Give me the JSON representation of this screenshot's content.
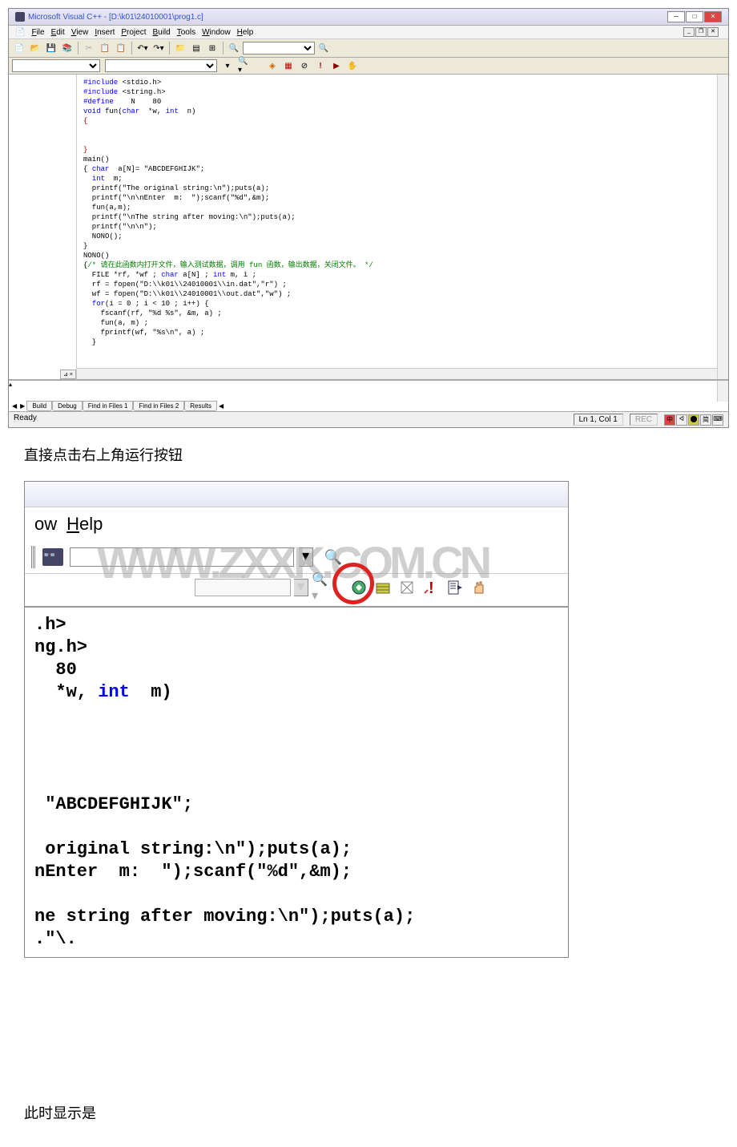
{
  "ide": {
    "title": "Microsoft Visual C++ - [D:\\k01\\24010001\\prog1.c]",
    "menubar": {
      "file": "File",
      "edit": "Edit",
      "view": "View",
      "insert": "Insert",
      "project": "Project",
      "build": "Build",
      "tools": "Tools",
      "window": "Window",
      "help": "Help"
    },
    "code": {
      "l1a": "#include",
      "l1b": " <stdio.h>",
      "l2a": "#include",
      "l2b": " <string.h>",
      "l3a": "#define",
      "l3b": "    N    80",
      "l4a": "void",
      "l4b": " fun(",
      "l4c": "char",
      "l4d": "  *w, ",
      "l4e": "int",
      "l4f": "  n)",
      "l5": "{",
      "l6": "",
      "l7": "}",
      "l8": "main()",
      "l9a": "{ ",
      "l9b": "char",
      "l9c": "  a[N]= \"ABCDEFGHIJK\";",
      "l10a": "  ",
      "l10b": "int",
      "l10c": "  m;",
      "l11": "  printf(\"The original string:\\n\");puts(a);",
      "l12": "  printf(\"\\n\\nEnter  m:  \");scanf(\"%d\",&m);",
      "l13": "  fun(a,m);",
      "l14": "  printf(\"\\nThe string after moving:\\n\");puts(a);",
      "l15": "  printf(\"\\n\\n\");",
      "l16": "  NONO();",
      "l17": "}",
      "l18": "NONO()",
      "l19a": "{",
      "l19b": "/* 请在此函数内打开文件，输入测试数据，调用 fun 函数，输出数据，关闭文件。 */",
      "l20": "  FILE *rf, *wf ; ",
      "l20b": "char",
      "l20c": " a[N] ; ",
      "l20d": "int",
      "l20e": " m, i ;",
      "l21": "  rf = fopen(\"D:\\\\k01\\\\24010001\\\\in.dat\",\"r\") ;",
      "l22": "  wf = fopen(\"D:\\\\k01\\\\24010001\\\\out.dat\",\"w\") ;",
      "l23a": "  ",
      "l23b": "for",
      "l23c": "(i = 0 ; i < 10 ; i++) {",
      "l24": "    fscanf(rf, \"%d %s\", &m, a) ;",
      "l25": "    fun(a, m) ;",
      "l26": "    fprintf(wf, \"%s\\n\", a) ;",
      "l27": "  }"
    },
    "output_tabs": {
      "build": "Build",
      "debug": "Debug",
      "find1": "Find in Files 1",
      "find2": "Find in Files 2",
      "results": "Results"
    },
    "statusbar": {
      "ready": "Ready",
      "pos": "Ln 1, Col 1",
      "rec": "REC"
    }
  },
  "caption1": "直接点击右上角运行按钮",
  "zoomed": {
    "menu_window": "ow",
    "menu_help": "Help",
    "watermark": "WWW.ZXXK.COM.CN",
    "code": {
      "l1": ".h>",
      "l2": "ng.h>",
      "l3": "  80",
      "l4a": "  *w, ",
      "l4b": "int",
      "l4c": "  m)",
      "gap": " ",
      "l5": " \"ABCDEFGHIJK\";",
      "gap2": " ",
      "l6": " original string:\\n\");puts(a);",
      "l7": "nEnter  m:  \");scanf(\"%d\",&m);",
      "gap3": " ",
      "l8": "ne string after moving:\\n\");puts(a);",
      "l9": ".\"\\."
    }
  },
  "caption2": "此时显示是"
}
